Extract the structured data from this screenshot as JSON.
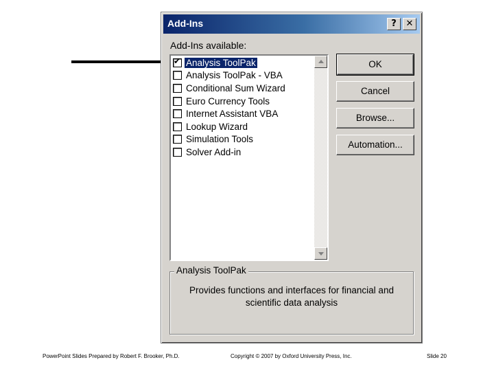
{
  "dialog": {
    "title": "Add-Ins",
    "help_button": "?",
    "close_button": "✕",
    "list_label": "Add-Ins available:",
    "items": [
      {
        "label": "Analysis ToolPak",
        "checked": true,
        "selected": true
      },
      {
        "label": "Analysis ToolPak - VBA",
        "checked": false
      },
      {
        "label": "Conditional Sum Wizard",
        "checked": false
      },
      {
        "label": "Euro Currency Tools",
        "checked": false
      },
      {
        "label": "Internet Assistant VBA",
        "checked": false
      },
      {
        "label": "Lookup Wizard",
        "checked": false
      },
      {
        "label": "Simulation Tools",
        "checked": false
      },
      {
        "label": "Solver Add-in",
        "checked": false
      }
    ],
    "buttons": {
      "ok": "OK",
      "cancel": "Cancel",
      "browse": "Browse...",
      "automation": "Automation..."
    },
    "description": {
      "title": "Analysis ToolPak",
      "text": "Provides functions and interfaces for financial and scientific data analysis"
    }
  },
  "footer": {
    "left": "PowerPoint Slides Prepared by Robert F. Brooker, Ph.D.",
    "center": "Copyright © 2007 by Oxford University Press, Inc.",
    "right": "Slide 20"
  },
  "annotation": {
    "icon": "arrow-right-icon",
    "color": "#000000"
  },
  "colors": {
    "titlebar_start": "#0a246a",
    "titlebar_end": "#a6caf0",
    "dialog_bg": "#d6d3ce",
    "selection": "#0a246a"
  }
}
